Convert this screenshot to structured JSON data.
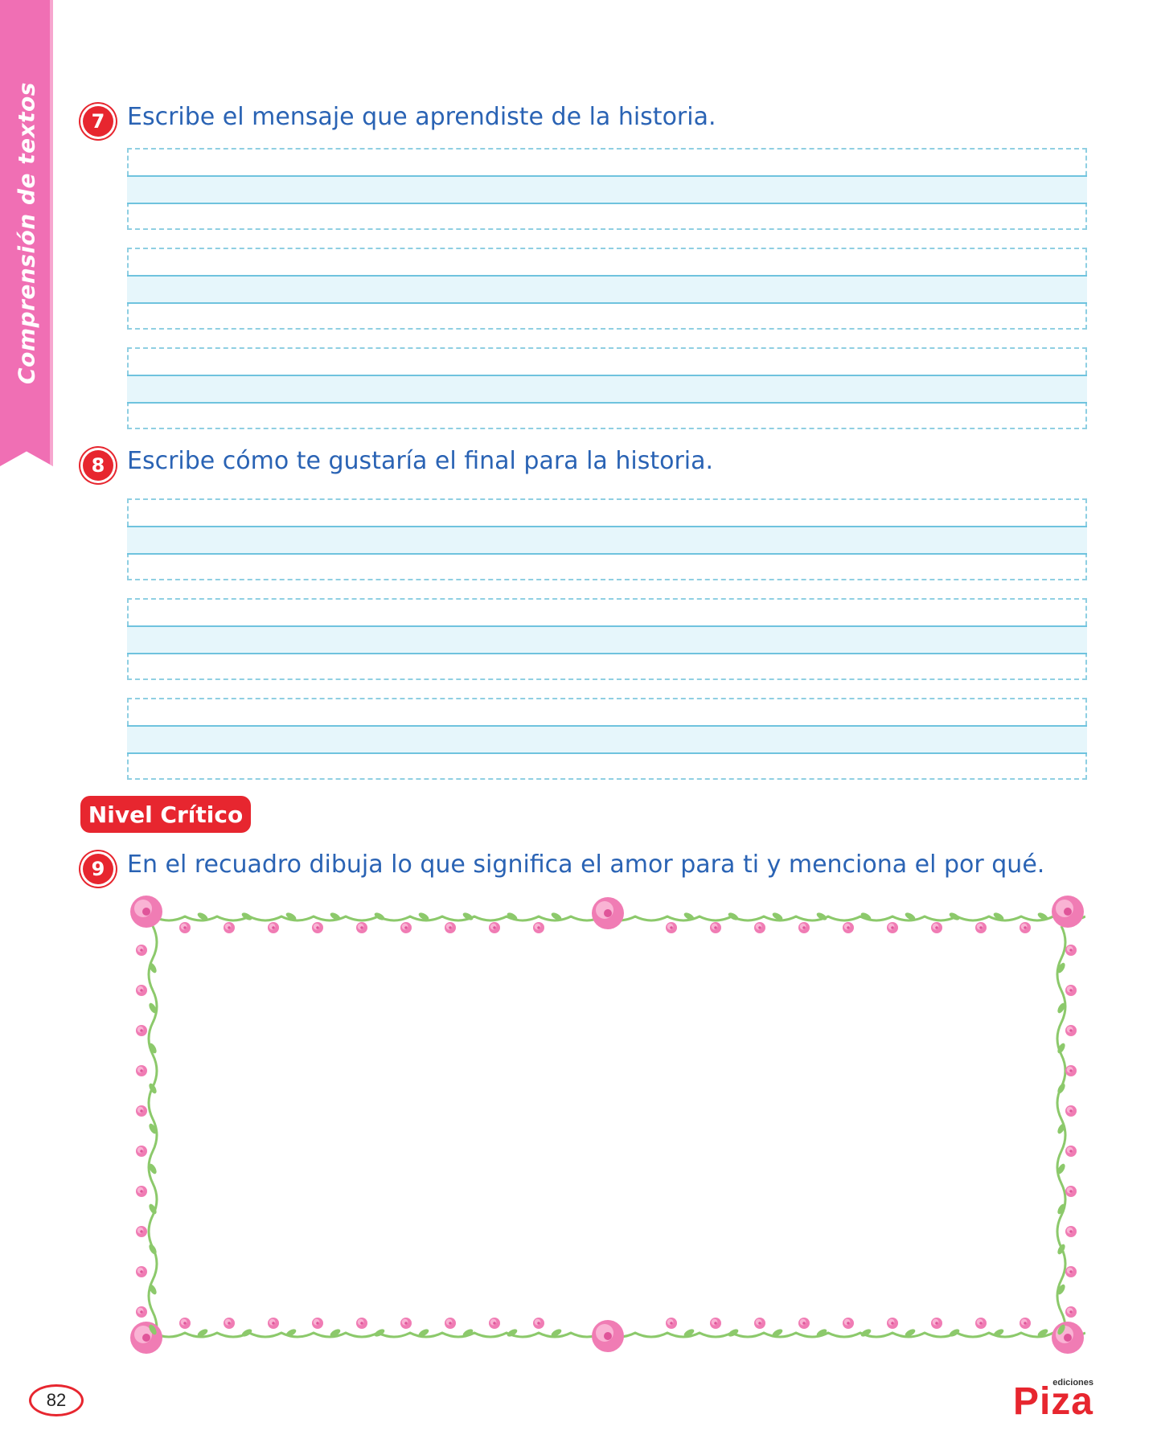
{
  "sidebar": {
    "label": "Comprensión de textos"
  },
  "questions": [
    {
      "number": "7",
      "text": "Escribe el mensaje que aprendiste de la historia."
    },
    {
      "number": "8",
      "text": "Escribe cómo te gustaría el final para la historia."
    },
    {
      "number": "9",
      "text": "En el recuadro dibuja lo que significa el amor para ti y menciona el por qué."
    }
  ],
  "level_badge": "Nivel Crítico",
  "page_number": "82",
  "brand": {
    "small": "ediciones",
    "main": "Piza"
  },
  "colors": {
    "accent_red": "#e7262f",
    "ribbon_pink": "#f06fb4",
    "question_blue": "#2a63b4",
    "line_cyan": "#8fcfe2",
    "band_fill": "#e6f6fb",
    "rose_pink": "#f07cb4",
    "vine_green": "#8cc96b"
  },
  "icons": {
    "frame": "floral-border-icon"
  }
}
